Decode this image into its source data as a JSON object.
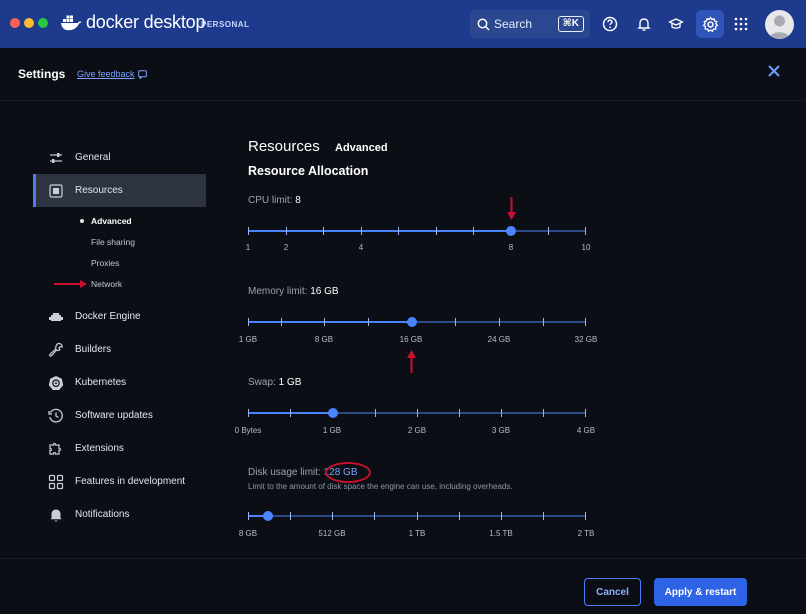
{
  "titlebar": {
    "brand": "docker desktop",
    "badge": "PERSONAL",
    "search_label": "Search",
    "search_shortcut": "⌘K",
    "colors": {
      "bar": "#1d3a8c",
      "active_icon": "#2f55b8"
    },
    "icons": [
      "help-icon",
      "bell-icon",
      "learn-icon",
      "gear-icon",
      "apps-grid-icon"
    ]
  },
  "header": {
    "title": "Settings",
    "feedback": "Give feedback"
  },
  "sidebar": {
    "items": [
      {
        "label": "General",
        "icon": "sliders-icon"
      },
      {
        "label": "Resources",
        "icon": "resources-icon",
        "selected": true
      },
      {
        "label": "Docker Engine",
        "icon": "engine-icon"
      },
      {
        "label": "Builders",
        "icon": "wrench-icon"
      },
      {
        "label": "Kubernetes",
        "icon": "helm-icon"
      },
      {
        "label": "Software updates",
        "icon": "clock-icon"
      },
      {
        "label": "Extensions",
        "icon": "puzzle-icon"
      },
      {
        "label": "Features in development",
        "icon": "grid-icon"
      },
      {
        "label": "Notifications",
        "icon": "bell-icon"
      }
    ],
    "subitems": [
      {
        "label": "Advanced",
        "active": true
      },
      {
        "label": "File sharing"
      },
      {
        "label": "Proxies"
      },
      {
        "label": "Network"
      }
    ]
  },
  "main": {
    "title": "Resources",
    "tab": "Advanced",
    "section": "Resource Allocation",
    "cpu": {
      "label": "CPU limit:",
      "value": "8",
      "ticks": [
        "1",
        "2",
        "4",
        "8",
        "10"
      ],
      "level": 0.7778
    },
    "memory": {
      "label": "Memory limit:",
      "value": "16 GB",
      "ticks": [
        "1 GB",
        "8 GB",
        "16 GB",
        "24 GB",
        "32 GB"
      ],
      "level": 0.4839
    },
    "swap": {
      "label": "Swap:",
      "value": "1 GB",
      "ticks": [
        "0 Bytes",
        "1 GB",
        "2 GB",
        "3 GB",
        "4 GB"
      ],
      "level": 0.25
    },
    "disk": {
      "label": "Disk usage limit:",
      "value": "128 GB",
      "hint": "Limit to the amount of disk space the engine can use, including overheads.",
      "ticks": [
        "8 GB",
        "512 GB",
        "1 TB",
        "1.5 TB",
        "2 TB"
      ],
      "level": 0.06
    }
  },
  "footer": {
    "cancel": "Cancel",
    "apply": "Apply & restart",
    "accent": "#2f63e6"
  }
}
